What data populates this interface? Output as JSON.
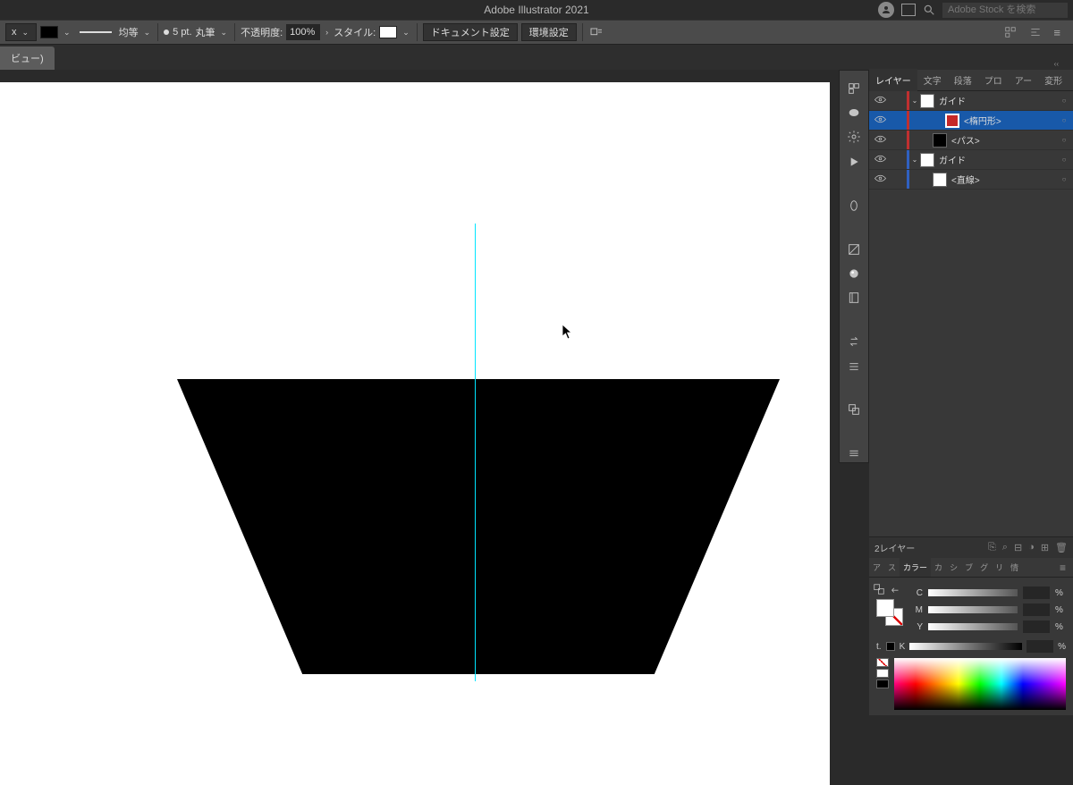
{
  "titlebar": {
    "title": "Adobe Illustrator 2021",
    "search_placeholder": "Adobe Stock を検索"
  },
  "controlbar": {
    "unit_suffix": "x",
    "stroke_uniform": "均等",
    "stroke_preset_pt": "5 pt.",
    "stroke_preset_brush": "丸筆",
    "opacity_label": "不透明度:",
    "opacity_value": "100%",
    "style_label": "スタイル:",
    "doc_setup": "ドキュメント設定",
    "pref_setup": "環境設定"
  },
  "doctab": {
    "label": "ビュー)"
  },
  "panels": {
    "layers_tabs": [
      "レイヤー",
      "文字",
      "段落",
      "プロ",
      "アー",
      "変形"
    ],
    "layers_active": 0,
    "layer_items": [
      {
        "name": "ガイド",
        "depth": 0,
        "toggle": true,
        "thumb": "white",
        "bar": "red",
        "selected": false
      },
      {
        "name": "<楕円形>",
        "depth": 2,
        "toggle": false,
        "thumb": "red",
        "bar": "red",
        "selected": true
      },
      {
        "name": "<パス>",
        "depth": 1,
        "toggle": false,
        "thumb": "black",
        "bar": "red",
        "selected": false
      },
      {
        "name": "ガイド",
        "depth": 0,
        "toggle": true,
        "thumb": "white",
        "bar": "blue",
        "selected": false
      },
      {
        "name": "<直線>",
        "depth": 1,
        "toggle": false,
        "thumb": "white",
        "bar": "blue",
        "selected": false
      }
    ],
    "layer_count_label": "2レイヤー",
    "color_tabs": [
      "ア",
      "ス",
      "カラー",
      "カ",
      "シ",
      "ブ",
      "グ",
      "リ",
      "情"
    ],
    "color_active": 2,
    "channels": [
      "C",
      "M",
      "Y",
      "K"
    ],
    "percent": "%"
  }
}
